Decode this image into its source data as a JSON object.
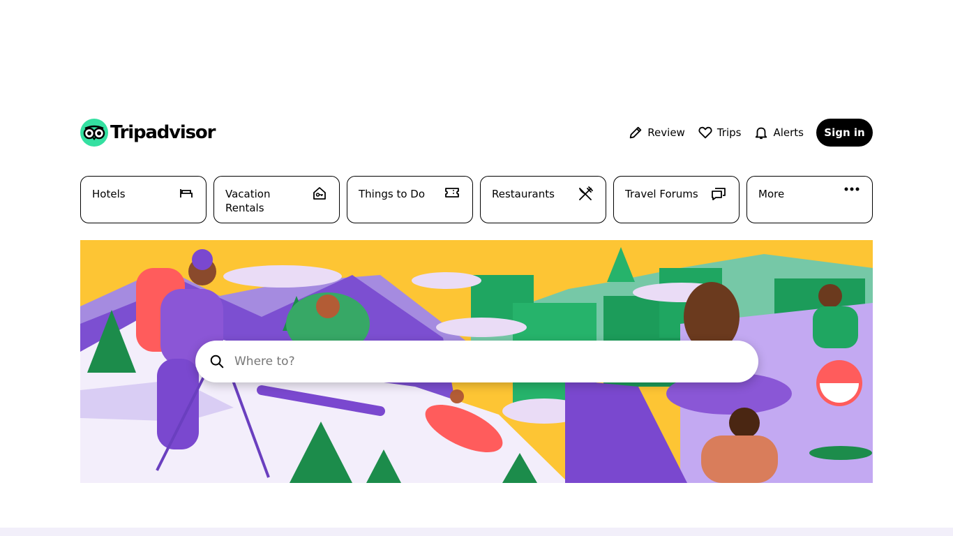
{
  "brand": {
    "name": "Tripadvisor",
    "accent": "#34e0a1"
  },
  "header": {
    "nav": [
      {
        "label": "Review",
        "icon": "pencil-icon"
      },
      {
        "label": "Trips",
        "icon": "heart-icon"
      },
      {
        "label": "Alerts",
        "icon": "bell-icon"
      }
    ],
    "signin_label": "Sign in"
  },
  "categories": [
    {
      "label": "Hotels",
      "icon": "bed-icon"
    },
    {
      "label": "Vacation Rentals",
      "icon": "house-key-icon"
    },
    {
      "label": "Things to Do",
      "icon": "ticket-icon"
    },
    {
      "label": "Restaurants",
      "icon": "fork-knife-icon"
    },
    {
      "label": "Travel Forums",
      "icon": "chat-bubbles-icon"
    },
    {
      "label": "More",
      "icon": "more-dots-icon"
    }
  ],
  "search": {
    "placeholder": "Where to?"
  },
  "colors": {
    "hero_sky": "#fdc534",
    "hero_purple": "#8b5cf6",
    "hero_green": "#1fa661",
    "footer_band": "#f2effa"
  }
}
